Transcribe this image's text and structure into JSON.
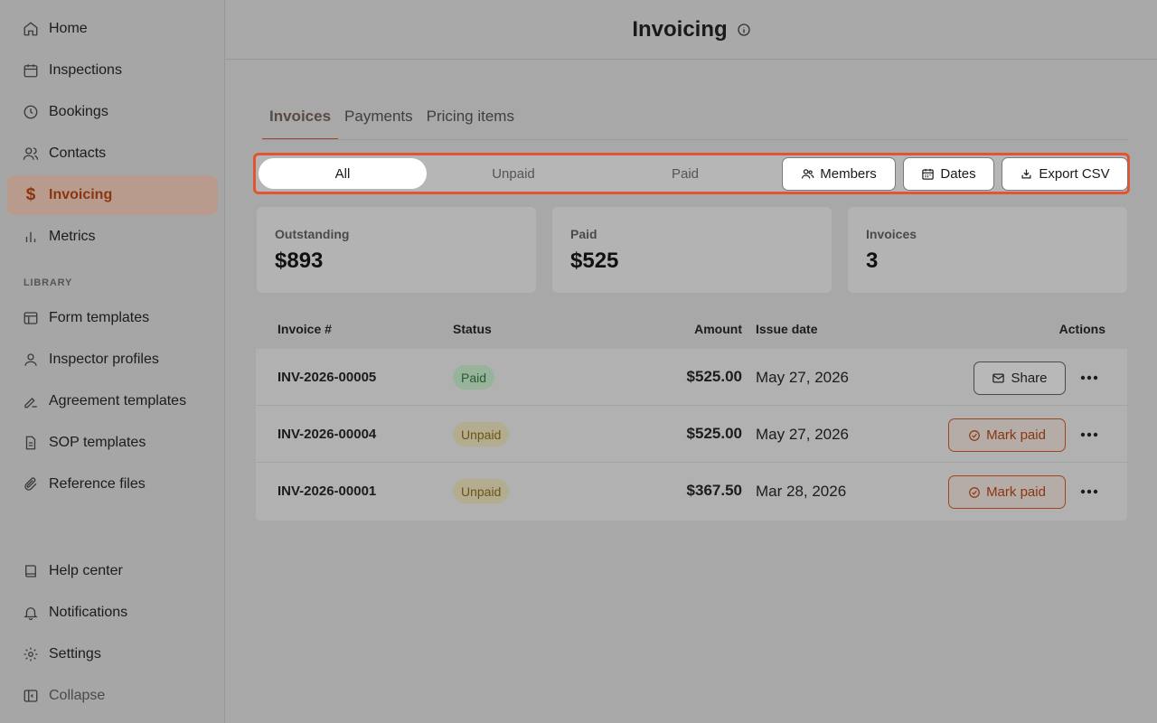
{
  "colors": {
    "accent": "#8a3510",
    "highlight_border": "#e4542f"
  },
  "sidebar": {
    "items": [
      {
        "label": "Home",
        "icon": "home-icon"
      },
      {
        "label": "Inspections",
        "icon": "calendar-icon"
      },
      {
        "label": "Bookings",
        "icon": "clock-icon"
      },
      {
        "label": "Contacts",
        "icon": "users-icon"
      },
      {
        "label": "Invoicing",
        "icon": "dollar-icon",
        "active": true
      },
      {
        "label": "Metrics",
        "icon": "bar-chart-icon"
      }
    ],
    "library_label": "LIBRARY",
    "library_items": [
      {
        "label": "Form templates",
        "icon": "layout-icon"
      },
      {
        "label": "Inspector profiles",
        "icon": "user-icon"
      },
      {
        "label": "Agreement templates",
        "icon": "signature-icon"
      },
      {
        "label": "SOP templates",
        "icon": "document-icon"
      },
      {
        "label": "Reference files",
        "icon": "paperclip-icon"
      }
    ],
    "bottom_items": [
      {
        "label": "Help center",
        "icon": "book-icon"
      },
      {
        "label": "Notifications",
        "icon": "bell-icon"
      },
      {
        "label": "Settings",
        "icon": "gear-icon"
      },
      {
        "label": "Collapse",
        "icon": "sidebar-collapse-icon"
      }
    ]
  },
  "header": {
    "title": "Invoicing",
    "info_icon": "info-icon"
  },
  "tabs": [
    {
      "label": "Invoices",
      "active": true
    },
    {
      "label": "Payments"
    },
    {
      "label": "Pricing items"
    }
  ],
  "filters": {
    "segments": [
      "All",
      "Unpaid",
      "Paid"
    ],
    "selected": "All",
    "members_label": "Members",
    "dates_label": "Dates",
    "export_label": "Export CSV"
  },
  "stats": [
    {
      "label": "Outstanding",
      "value": "$893"
    },
    {
      "label": "Paid",
      "value": "$525"
    },
    {
      "label": "Invoices",
      "value": "3"
    }
  ],
  "table": {
    "columns": [
      "Invoice #",
      "Status",
      "Amount",
      "Issue date",
      "Actions"
    ],
    "rows": [
      {
        "invoice": "INV-2026-00005",
        "status": "Paid",
        "amount": "$525.00",
        "issue_date": "May 27, 2026",
        "action": "Share"
      },
      {
        "invoice": "INV-2026-00004",
        "status": "Unpaid",
        "amount": "$525.00",
        "issue_date": "May 27, 2026",
        "action": "Mark paid"
      },
      {
        "invoice": "INV-2026-00001",
        "status": "Unpaid",
        "amount": "$367.50",
        "issue_date": "Mar 28, 2026",
        "action": "Mark paid"
      }
    ]
  }
}
